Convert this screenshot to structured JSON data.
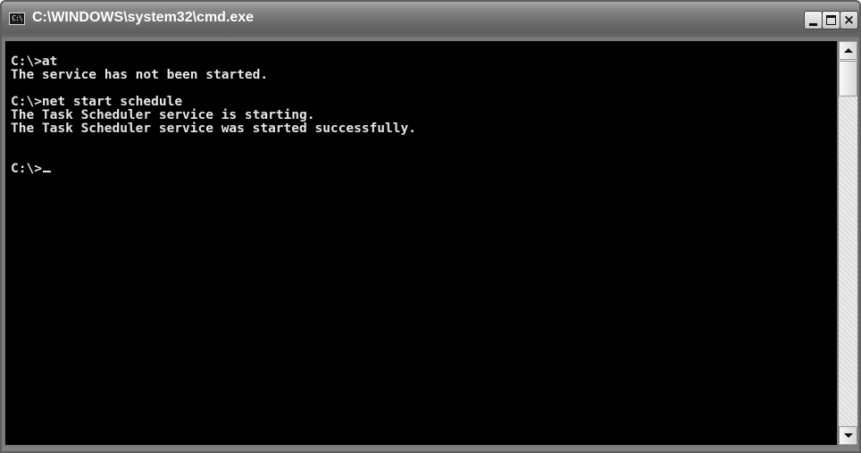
{
  "window": {
    "title": "C:\\WINDOWS\\system32\\cmd.exe",
    "icon": "cmd-icon",
    "icon_text": "C:\\",
    "buttons": {
      "minimize": "minimize-icon",
      "maximize": "maximize-icon",
      "close": "close-icon",
      "close_glyph": "×"
    }
  },
  "console": {
    "lines": [
      "C:\\>at",
      "The service has not been started.",
      "",
      "C:\\>net start schedule",
      "The Task Scheduler service is starting.",
      "The Task Scheduler service was started successfully.",
      "",
      "",
      "C:\\>"
    ],
    "text_color": "#e6e6e6",
    "background_color": "#000000"
  },
  "scrollbar": {
    "up": "scroll-up-arrow-icon",
    "down": "scroll-down-arrow-icon"
  }
}
